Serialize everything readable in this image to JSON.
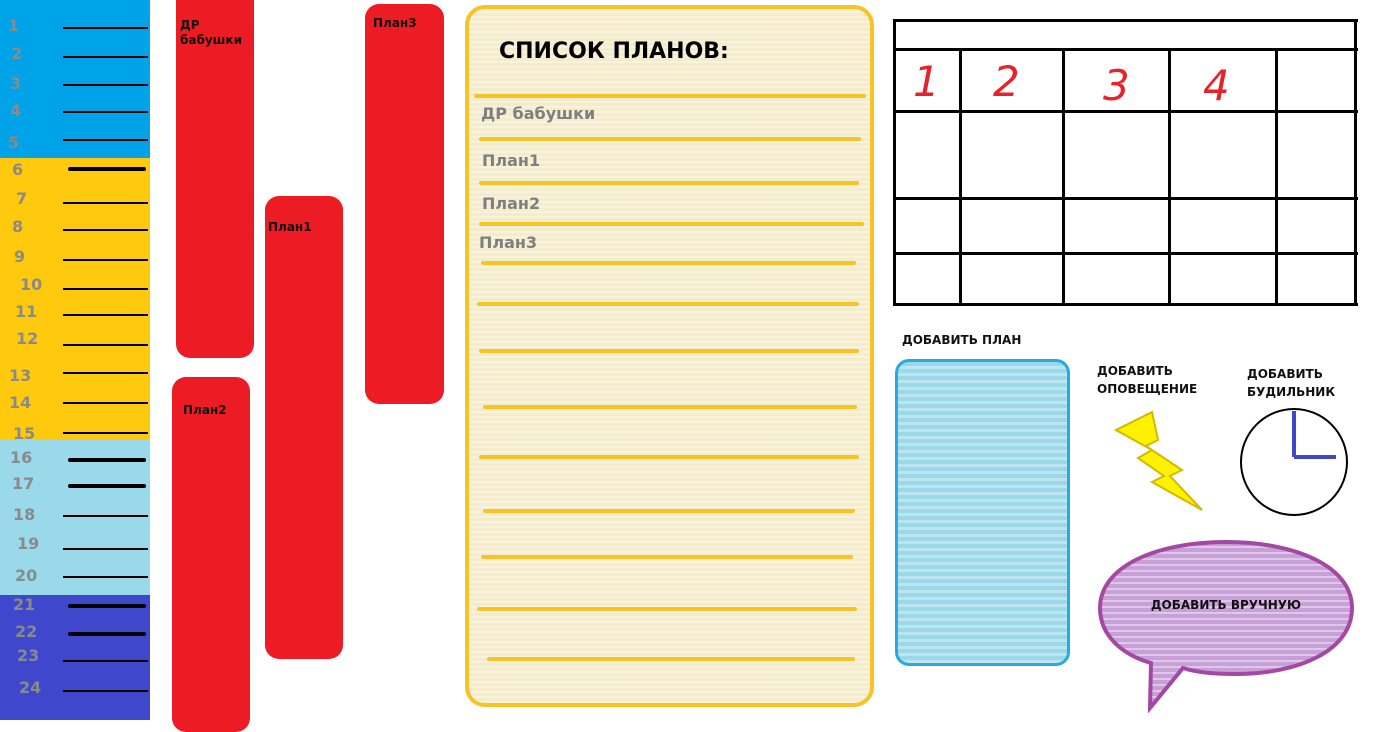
{
  "ruler": {
    "hours": [
      "1",
      "2",
      "3",
      "4",
      "5",
      "6",
      "7",
      "8",
      "9",
      "10",
      "11",
      "12",
      "13",
      "14",
      "15",
      "16",
      "17",
      "18",
      "19",
      "20",
      "21",
      "22",
      "23",
      "24"
    ],
    "band_colors": [
      "#00a2e8",
      "#ffc90e",
      "#99d9ea",
      "#3f48cc"
    ]
  },
  "plan_bars": [
    {
      "label": "ДР бабушки"
    },
    {
      "label": "План1"
    },
    {
      "label": "План2"
    },
    {
      "label": "План3"
    }
  ],
  "plan_list": {
    "title": "СПИСОК ПЛАНОВ:",
    "items": [
      "ДР бабушки",
      "План1",
      "План2",
      "План3"
    ]
  },
  "calendar": {
    "days": [
      "1",
      "2",
      "3",
      "4"
    ]
  },
  "actions": {
    "add_plan": "ДОБАВИТЬ ПЛАН",
    "add_notification": "ДОБАВИТЬ ОПОВЕЩЕНИЕ",
    "add_alarm": "ДОБАВИТЬ БУДИЛЬНИК",
    "add_manual": "ДОБАВИТЬ ВРУЧНУЮ"
  },
  "colors": {
    "plan_bar": "#ed1c24",
    "list_border": "#f7c325",
    "add_plan_border": "#27aae1",
    "bubble": "#c8a0d8",
    "bubble_border": "#a349a4",
    "lightning": "#fff200",
    "clock_hands": "#3f48cc"
  }
}
